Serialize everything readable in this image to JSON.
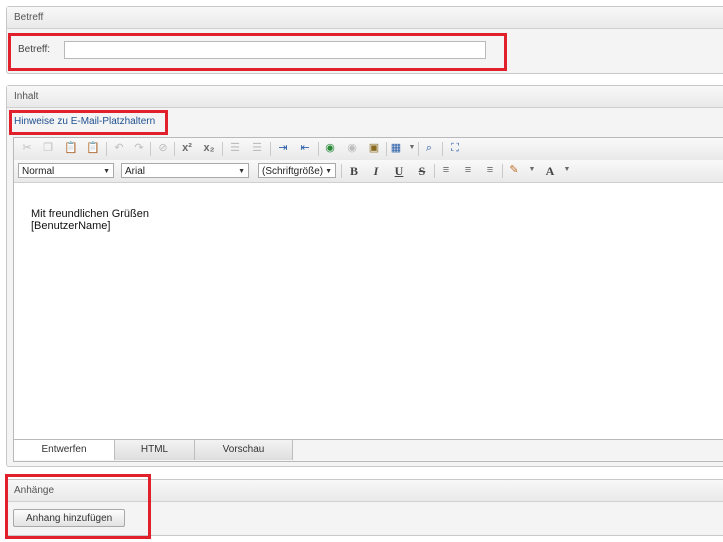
{
  "betreff_section": {
    "title": "Betreff",
    "label": "Betreff:",
    "value": ""
  },
  "inhalt_section": {
    "title": "Inhalt",
    "hint_link": "Hinweise zu E-Mail-Platzhaltern"
  },
  "editor": {
    "paragraph_format": "Normal",
    "font_name": "Arial",
    "font_size": "(Schriftgröße)",
    "bold": "B",
    "italic": "I",
    "underline": "U",
    "strike": "S",
    "font_color": "A",
    "superscript": "x²",
    "subscript": "x₂",
    "content_line1": "Mit freundlichen Grüßen",
    "content_line2": "[BenutzerName]",
    "tabs": [
      "Entwerfen",
      "HTML",
      "Vorschau"
    ],
    "active_tab": "Entwerfen"
  },
  "anhaenge_section": {
    "title": "Anhänge",
    "add_button": "Anhang hinzufügen"
  },
  "colors": {
    "highlight_box": "#e0202a",
    "link": "#1f4f8f"
  }
}
